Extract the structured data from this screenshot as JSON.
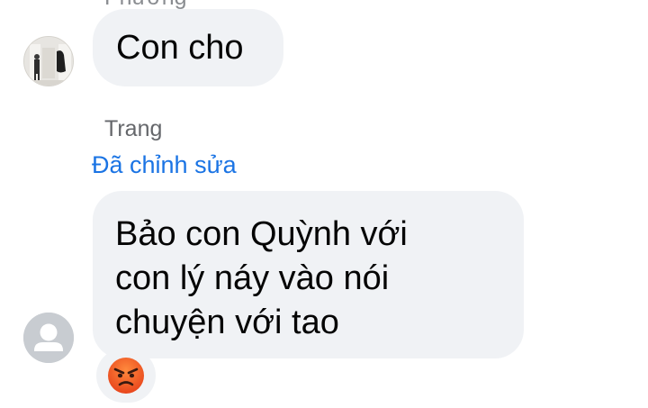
{
  "messages": [
    {
      "sender": "Phương",
      "text_lines": [
        "Con cho"
      ]
    },
    {
      "sender": "Trang",
      "edited_label": "Đã chỉnh sửa",
      "text_lines": [
        "Bảo con Quỳnh với",
        "con lý náy vào nói",
        "chuyện với tao"
      ],
      "reaction": "angry-face-emoji"
    }
  ],
  "colors": {
    "bubble_bg": "#f0f2f5",
    "edited_label": "#1b74e4",
    "sender_name": "#65676b",
    "reaction_face": "#f35b1e"
  }
}
